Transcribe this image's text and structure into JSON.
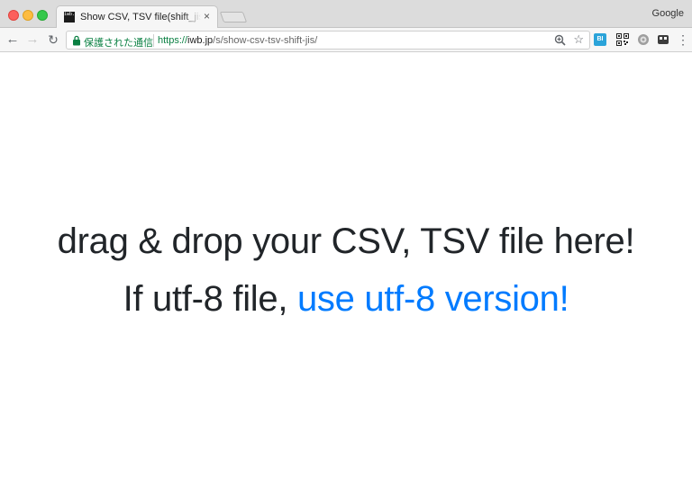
{
  "browser": {
    "tab_title": "Show CSV, TSV file(shift_jis) in browser",
    "tab_close": "×",
    "favicon_text": "iwb.jp",
    "profile_name": "Google",
    "secure_label": "保護された通信",
    "url": {
      "scheme": "https://",
      "host": "iwb.jp",
      "path": "/s/show-csv-tsv-shift-jis/"
    },
    "extension_label": "BI"
  },
  "page": {
    "headline": "drag & drop your CSV, TSV file here!",
    "subline_prefix": "If utf-8 file, ",
    "subline_link": "use utf-8 version!"
  },
  "colors": {
    "text": "#212529",
    "link": "#007bff",
    "secure": "#0b8043"
  }
}
